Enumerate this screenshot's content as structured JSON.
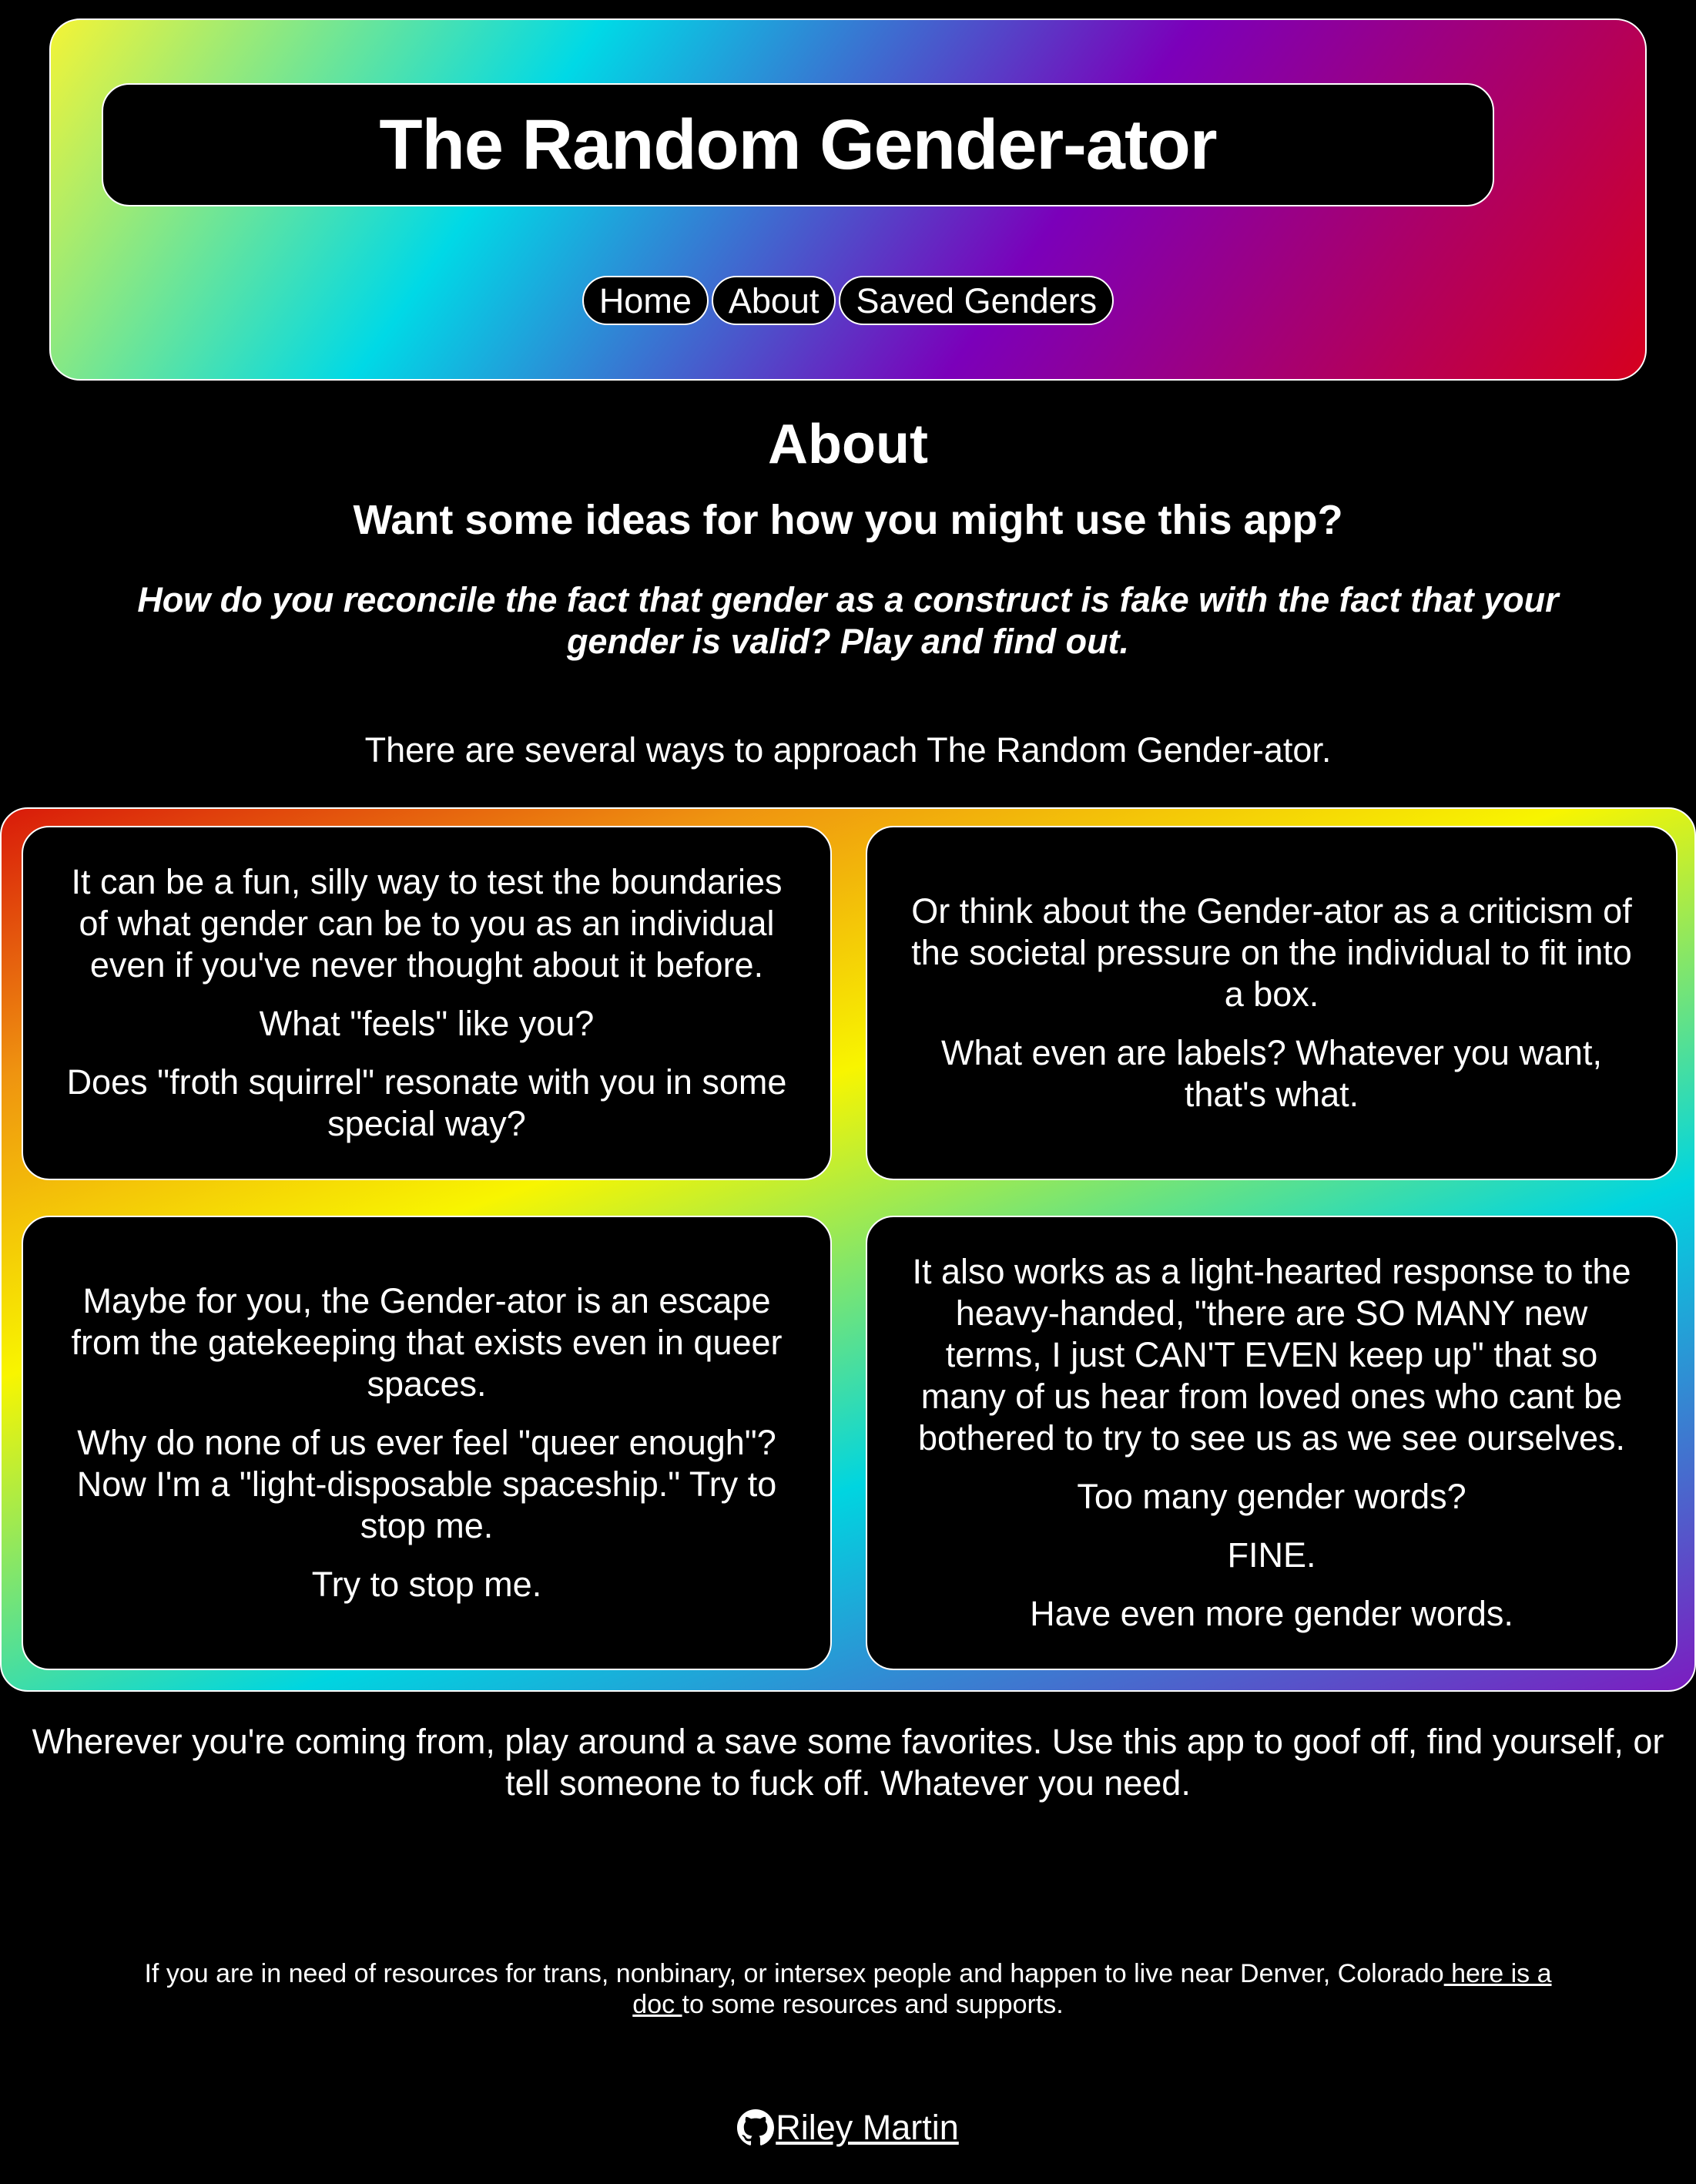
{
  "header": {
    "title": "The Random Gender-ator",
    "nav": {
      "home": "Home",
      "about": "About",
      "saved": "Saved Genders"
    }
  },
  "main": {
    "page_title": "About",
    "subtitle": "Want some ideas for how you might use this app?",
    "tagline": "How do you reconcile the fact that gender as a construct is fake with the fact that your gender is valid? Play and find out.",
    "intro": "There are several ways to approach The Random Gender-ator.",
    "cards": [
      {
        "paragraphs": [
          "It can be a fun, silly way to test the boundaries of what gender can be to you as an individual even if you've never thought about it before.",
          "What \"feels\" like you?",
          "Does \"froth squirrel\" resonate with you in some special way?"
        ]
      },
      {
        "paragraphs": [
          "Or think about the Gender-ator as a criticism of the societal pressure on the individual to fit into a box.",
          "What even are labels? Whatever you want, that's what."
        ]
      },
      {
        "paragraphs": [
          "Maybe for you, the Gender-ator is an escape from the gatekeeping that exists even in queer spaces.",
          "Why do none of us ever feel \"queer enough\"? Now I'm a \"light-disposable spaceship.\" Try to stop me.",
          "Try to stop me."
        ]
      },
      {
        "paragraphs": [
          "It also works as a light-hearted response to the heavy-handed, \"there are SO MANY new terms, I just CAN'T EVEN keep up\" that so many of us hear from loved ones who cant be bothered to try to see us as we see ourselves.",
          "Too many gender words?",
          "FINE.",
          "Have even more gender words."
        ]
      }
    ],
    "closing": "Wherever you're coming from, play around a save some favorites. Use this app to goof off, find yourself, or tell someone to fuck off. Whatever you need.",
    "resources": {
      "before": "If you are in need of resources for trans, nonbinary, or intersex people and happen to live near Denver, Colorado",
      "link": " here is a doc ",
      "after": "to some resources and supports."
    }
  },
  "footer": {
    "icon": "github-icon",
    "author": "Riley Martin"
  }
}
